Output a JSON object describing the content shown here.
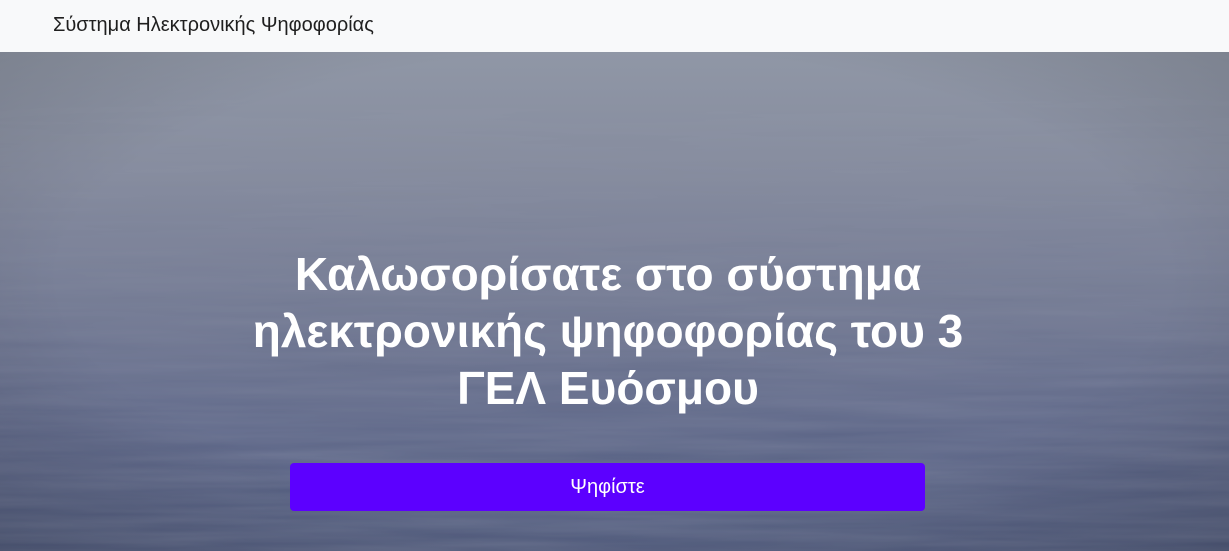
{
  "navbar": {
    "brand": "Σύστημα Ηλεκτρονικής Ψηφοφορίας"
  },
  "hero": {
    "title": "Καλωσορίσατε στο σύστημα ηλεκτρονικής ψηφοφορίας του 3 ΓΕΛ Ευόσμου",
    "button_label": "Ψηφίστε",
    "background_image": "sea-horizon-photo"
  },
  "colors": {
    "navbar_bg": "#f8f9fa",
    "brand_text": "#1f1f1f",
    "hero_text": "#ffffff",
    "button_bg": "#5c00ff",
    "button_text": "#ffffff"
  }
}
